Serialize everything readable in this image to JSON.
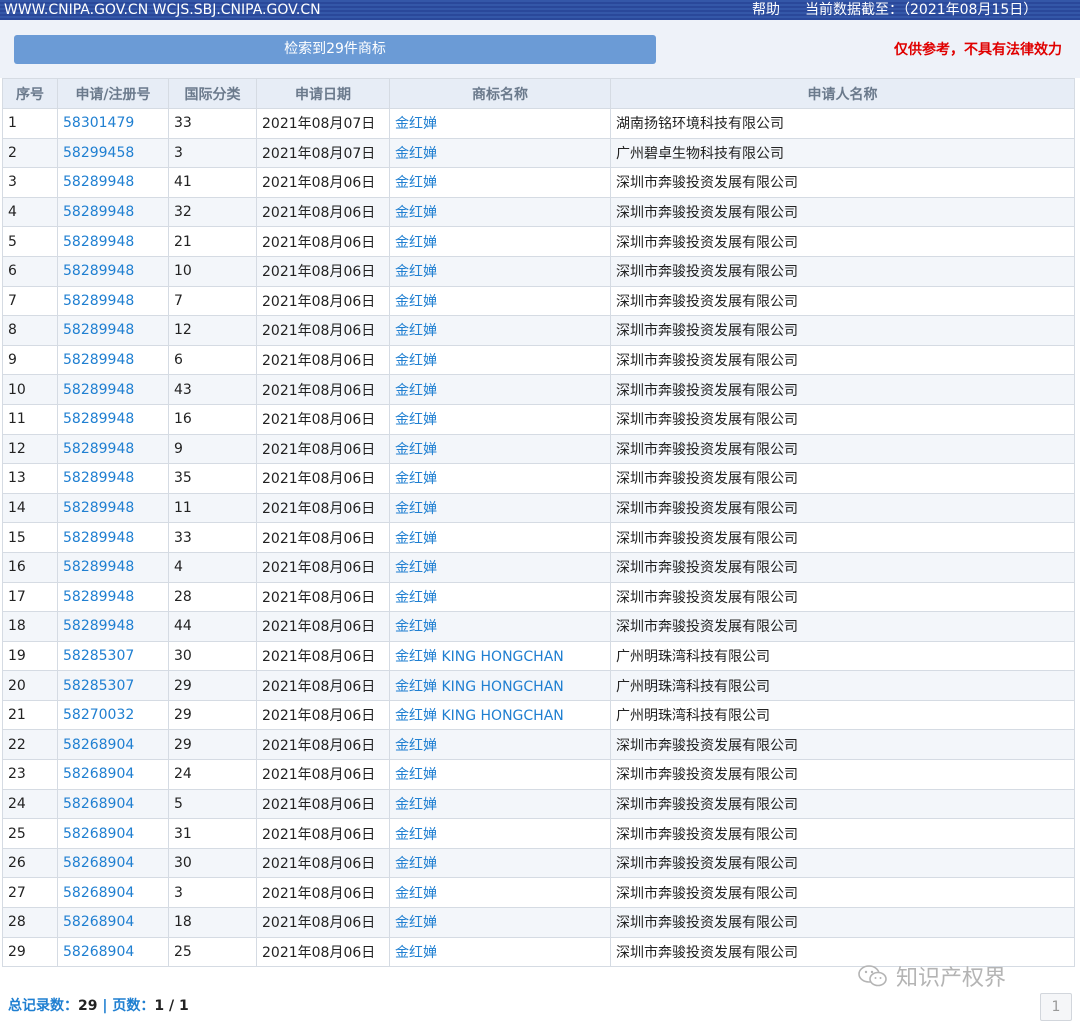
{
  "topbar": {
    "sites": "WWW.CNIPA.GOV.CN WCJS.SBJ.CNIPA.GOV.CN",
    "help": "帮助",
    "data_date": "当前数据截至：（2021年08月15日）"
  },
  "search_button": "检索到29件商标",
  "disclaimer": "仅供参考，不具有法律效力",
  "columns": [
    "序号",
    "申请/注册号",
    "国际分类",
    "申请日期",
    "商标名称",
    "申请人名称"
  ],
  "rows": [
    [
      "1",
      "58301479",
      "33",
      "2021年08月07日",
      "金红婵",
      "湖南扬铭环境科技有限公司"
    ],
    [
      "2",
      "58299458",
      "3",
      "2021年08月07日",
      "金红婵",
      "广州碧卓生物科技有限公司"
    ],
    [
      "3",
      "58289948",
      "41",
      "2021年08月06日",
      "金红婵",
      "深圳市奔骏投资发展有限公司"
    ],
    [
      "4",
      "58289948",
      "32",
      "2021年08月06日",
      "金红婵",
      "深圳市奔骏投资发展有限公司"
    ],
    [
      "5",
      "58289948",
      "21",
      "2021年08月06日",
      "金红婵",
      "深圳市奔骏投资发展有限公司"
    ],
    [
      "6",
      "58289948",
      "10",
      "2021年08月06日",
      "金红婵",
      "深圳市奔骏投资发展有限公司"
    ],
    [
      "7",
      "58289948",
      "7",
      "2021年08月06日",
      "金红婵",
      "深圳市奔骏投资发展有限公司"
    ],
    [
      "8",
      "58289948",
      "12",
      "2021年08月06日",
      "金红婵",
      "深圳市奔骏投资发展有限公司"
    ],
    [
      "9",
      "58289948",
      "6",
      "2021年08月06日",
      "金红婵",
      "深圳市奔骏投资发展有限公司"
    ],
    [
      "10",
      "58289948",
      "43",
      "2021年08月06日",
      "金红婵",
      "深圳市奔骏投资发展有限公司"
    ],
    [
      "11",
      "58289948",
      "16",
      "2021年08月06日",
      "金红婵",
      "深圳市奔骏投资发展有限公司"
    ],
    [
      "12",
      "58289948",
      "9",
      "2021年08月06日",
      "金红婵",
      "深圳市奔骏投资发展有限公司"
    ],
    [
      "13",
      "58289948",
      "35",
      "2021年08月06日",
      "金红婵",
      "深圳市奔骏投资发展有限公司"
    ],
    [
      "14",
      "58289948",
      "11",
      "2021年08月06日",
      "金红婵",
      "深圳市奔骏投资发展有限公司"
    ],
    [
      "15",
      "58289948",
      "33",
      "2021年08月06日",
      "金红婵",
      "深圳市奔骏投资发展有限公司"
    ],
    [
      "16",
      "58289948",
      "4",
      "2021年08月06日",
      "金红婵",
      "深圳市奔骏投资发展有限公司"
    ],
    [
      "17",
      "58289948",
      "28",
      "2021年08月06日",
      "金红婵",
      "深圳市奔骏投资发展有限公司"
    ],
    [
      "18",
      "58289948",
      "44",
      "2021年08月06日",
      "金红婵",
      "深圳市奔骏投资发展有限公司"
    ],
    [
      "19",
      "58285307",
      "30",
      "2021年08月06日",
      "金红婵 KING HONGCHAN",
      "广州明珠湾科技有限公司"
    ],
    [
      "20",
      "58285307",
      "29",
      "2021年08月06日",
      "金红婵 KING HONGCHAN",
      "广州明珠湾科技有限公司"
    ],
    [
      "21",
      "58270032",
      "29",
      "2021年08月06日",
      "金红婵 KING HONGCHAN",
      "广州明珠湾科技有限公司"
    ],
    [
      "22",
      "58268904",
      "29",
      "2021年08月06日",
      "金红婵",
      "深圳市奔骏投资发展有限公司"
    ],
    [
      "23",
      "58268904",
      "24",
      "2021年08月06日",
      "金红婵",
      "深圳市奔骏投资发展有限公司"
    ],
    [
      "24",
      "58268904",
      "5",
      "2021年08月06日",
      "金红婵",
      "深圳市奔骏投资发展有限公司"
    ],
    [
      "25",
      "58268904",
      "31",
      "2021年08月06日",
      "金红婵",
      "深圳市奔骏投资发展有限公司"
    ],
    [
      "26",
      "58268904",
      "30",
      "2021年08月06日",
      "金红婵",
      "深圳市奔骏投资发展有限公司"
    ],
    [
      "27",
      "58268904",
      "3",
      "2021年08月06日",
      "金红婵",
      "深圳市奔骏投资发展有限公司"
    ],
    [
      "28",
      "58268904",
      "18",
      "2021年08月06日",
      "金红婵",
      "深圳市奔骏投资发展有限公司"
    ],
    [
      "29",
      "58268904",
      "25",
      "2021年08月06日",
      "金红婵",
      "深圳市奔骏投资发展有限公司"
    ]
  ],
  "footer": {
    "total_label": "总记录数：",
    "total_value": "29",
    "separator": " | ",
    "pages_label": "页数：",
    "pages_value": "1 / 1"
  },
  "watermark_text": "知识产权界",
  "pager_current": "1",
  "colors": {
    "topbar": "#2f4f9f",
    "link": "#1f7fd1",
    "disclaimer": "#e00000",
    "search_button": "#6b9bd6"
  }
}
